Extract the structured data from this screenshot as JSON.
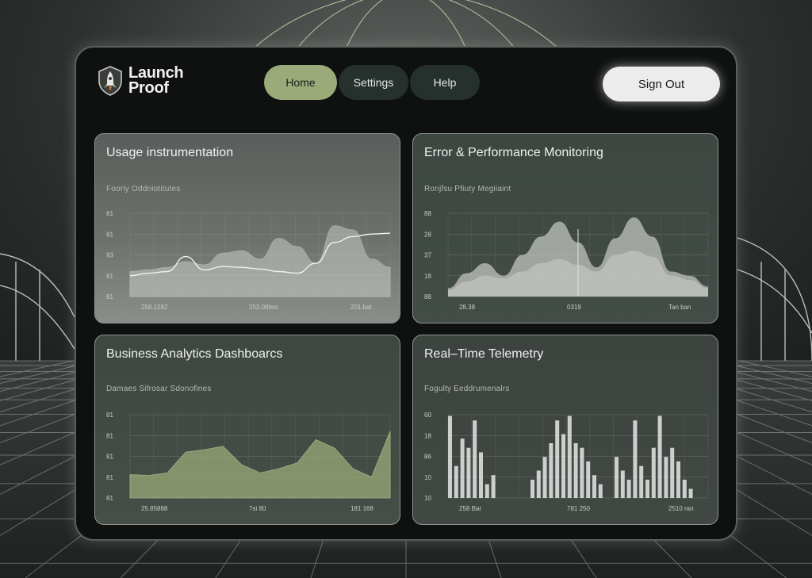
{
  "brand": {
    "name_line1": "Launch",
    "name_line2": "Proof"
  },
  "nav": {
    "items": [
      {
        "label": "Home",
        "active": true
      },
      {
        "label": "Settings",
        "active": false
      },
      {
        "label": "Help",
        "active": false
      }
    ]
  },
  "account": {
    "sign_out_label": "Sign Out"
  },
  "colors": {
    "accent": "#9aaa78",
    "window_bg": "#0f1111",
    "card_border": "#8f958f"
  },
  "cards": [
    {
      "title": "Usage instrumentation",
      "subtitle": "Fooriy Oddniotitutes",
      "y_ticks": [
        "81",
        "81",
        "93",
        "81",
        "81"
      ],
      "x_ticks": [
        "258.1282",
        "253.08bsn",
        "201.bat"
      ]
    },
    {
      "title": "Error & Performance Monitoring",
      "subtitle": "Ronjfsu Pfiuty Megiiaint",
      "y_ticks": [
        "88",
        "28",
        "37",
        "18",
        "88"
      ],
      "x_ticks": [
        "28.38",
        "0319",
        "Tan ban"
      ]
    },
    {
      "title": "Business Analytics Dashboarcs",
      "subtitle": "Damaes Sifrosar Sdonofines",
      "y_ticks": [
        "81",
        "81",
        "81",
        "81",
        "81"
      ],
      "x_ticks": [
        "25.85888",
        "7si 80",
        "181 168"
      ]
    },
    {
      "title": "Real–Time Telemetry",
      "subtitle": "Fogulty Eeddrumenalrs",
      "y_ticks": [
        "60",
        "18",
        "86",
        "10",
        "10"
      ],
      "x_ticks": [
        "258 Bar",
        "781 250",
        "2510 ran"
      ]
    }
  ],
  "chart_data": [
    {
      "type": "area",
      "title": "Usage instrumentation",
      "x": [
        0,
        1,
        2,
        3,
        4,
        5,
        6,
        7,
        8,
        9,
        10,
        11,
        12,
        13,
        14
      ],
      "series": [
        {
          "values": [
            30,
            32,
            35,
            42,
            38,
            52,
            55,
            45,
            70,
            60,
            40,
            85,
            80,
            45,
            35
          ]
        },
        {
          "values": [
            25,
            28,
            30,
            48,
            32,
            36,
            35,
            33,
            30,
            28,
            40,
            65,
            72,
            75,
            76
          ]
        }
      ],
      "ylim": [
        0,
        100
      ]
    },
    {
      "type": "area",
      "title": "Error & Performance Monitoring",
      "x": [
        0,
        1,
        2,
        3,
        4,
        5,
        6,
        7,
        8,
        9,
        10,
        11,
        12,
        13,
        14
      ],
      "series": [
        {
          "values": [
            10,
            28,
            40,
            25,
            50,
            72,
            90,
            65,
            35,
            70,
            95,
            72,
            30,
            25,
            12
          ]
        },
        {
          "values": [
            8,
            18,
            25,
            22,
            30,
            40,
            45,
            38,
            30,
            50,
            55,
            48,
            25,
            20,
            10
          ]
        }
      ],
      "ylim": [
        0,
        100
      ]
    },
    {
      "type": "area",
      "title": "Business Analytics Dashboarcs",
      "x": [
        0,
        1,
        2,
        3,
        4,
        5,
        6,
        7,
        8,
        9,
        10,
        11,
        12,
        13,
        14
      ],
      "values": [
        28,
        27,
        30,
        55,
        58,
        62,
        40,
        30,
        35,
        42,
        70,
        60,
        35,
        25,
        80
      ],
      "ylim": [
        0,
        100
      ]
    },
    {
      "type": "bar",
      "title": "Real–Time Telemetry",
      "groups": [
        [
          90,
          35,
          65,
          55,
          85,
          50,
          15,
          25
        ],
        [
          20,
          30,
          45,
          60,
          85,
          70,
          90,
          60,
          55,
          40,
          25,
          15
        ],
        [
          45,
          30,
          20,
          85,
          35,
          20,
          55,
          90,
          45,
          55,
          40,
          20,
          10
        ]
      ],
      "ylim": [
        0,
        100
      ]
    }
  ]
}
